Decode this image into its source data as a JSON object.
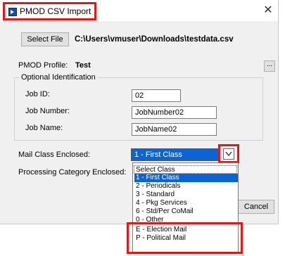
{
  "window": {
    "title": "PMOD CSV Import",
    "close_glyph": "✕"
  },
  "file": {
    "button_label": "Select File",
    "path": "C:\\Users\\vmuser\\Downloads\\testdata.csv"
  },
  "profile": {
    "label": "PMOD Profile:",
    "value": "Test",
    "browse_label": "..."
  },
  "identification": {
    "legend": "Optional Identification",
    "job_id": {
      "label": "Job ID:",
      "value": "02"
    },
    "job_number": {
      "label": "Job Number:",
      "value": "JobNumber02"
    },
    "job_name": {
      "label": "Job Name:",
      "value": "JobName02"
    }
  },
  "mail_class": {
    "label": "Mail Class Enclosed:",
    "selected": "1 - First Class"
  },
  "processing": {
    "label": "Processing Category Enclosed:"
  },
  "cancel_label": "Cancel",
  "dropdown_options": [
    "Select Class",
    "1 - First Class",
    "2 - Periodicals",
    "3 - Standard",
    "4 - Pkg Services",
    "6 - Std/Per CoMail",
    "0 - Other",
    "E - Election Mail",
    "P - Political Mail"
  ],
  "colors": {
    "highlight": "#e01818",
    "selection": "#0a64d4"
  }
}
